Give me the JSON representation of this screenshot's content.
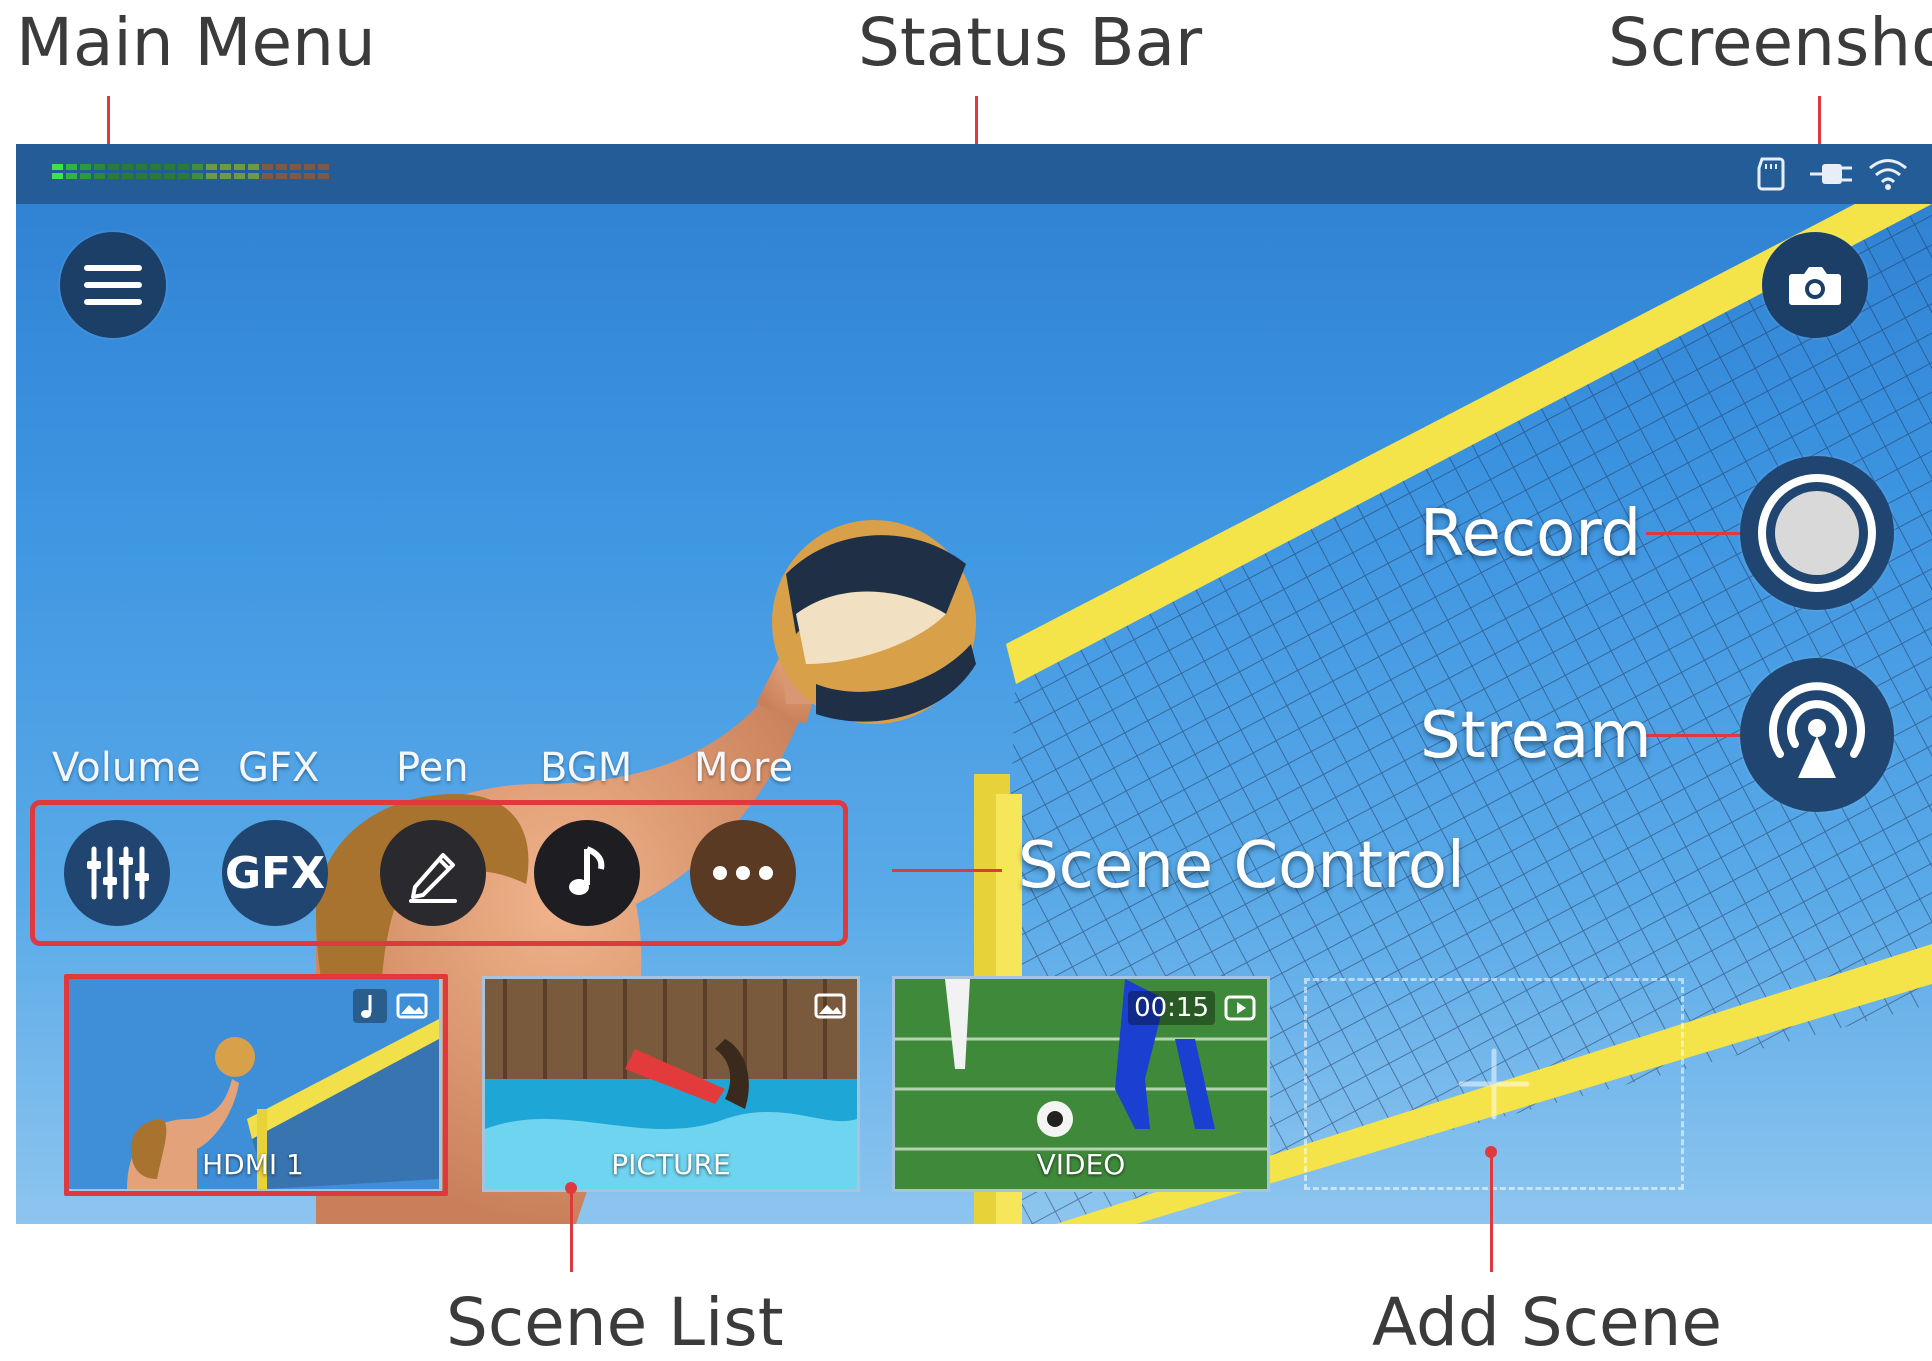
{
  "callouts": {
    "main_menu": "Main Menu",
    "status_bar": "Status Bar",
    "screenshot": "Screenshot",
    "record": "Record",
    "stream": "Stream",
    "scene_control": "Scene Control",
    "scene_list": "Scene List",
    "add_scene": "Add Scene"
  },
  "scene_controls": [
    {
      "label": "Volume",
      "icon": "mixer-sliders-icon"
    },
    {
      "label": "GFX",
      "icon": "gfx-icon",
      "glyph": "GFX"
    },
    {
      "label": "Pen",
      "icon": "pen-icon"
    },
    {
      "label": "BGM",
      "icon": "music-note-icon"
    },
    {
      "label": "More",
      "icon": "more-dots-icon"
    }
  ],
  "scenes": [
    {
      "label": "HDMI 1",
      "badges": [
        "music-note-icon",
        "image-icon"
      ],
      "selected": true
    },
    {
      "label": "PICTURE",
      "badges": [
        "image-icon"
      ],
      "selected": false
    },
    {
      "label": "VIDEO",
      "badges": [
        "video-play-icon"
      ],
      "duration": "00:15",
      "selected": false
    }
  ],
  "add_scene": {
    "icon": "plus-icon"
  },
  "status_icons": [
    "sd-card-icon",
    "power-plug-icon",
    "wifi-icon"
  ],
  "colors": {
    "accent_red": "#e0393d",
    "status_bar": "#245c98",
    "button_bg": "#1c3f68"
  }
}
